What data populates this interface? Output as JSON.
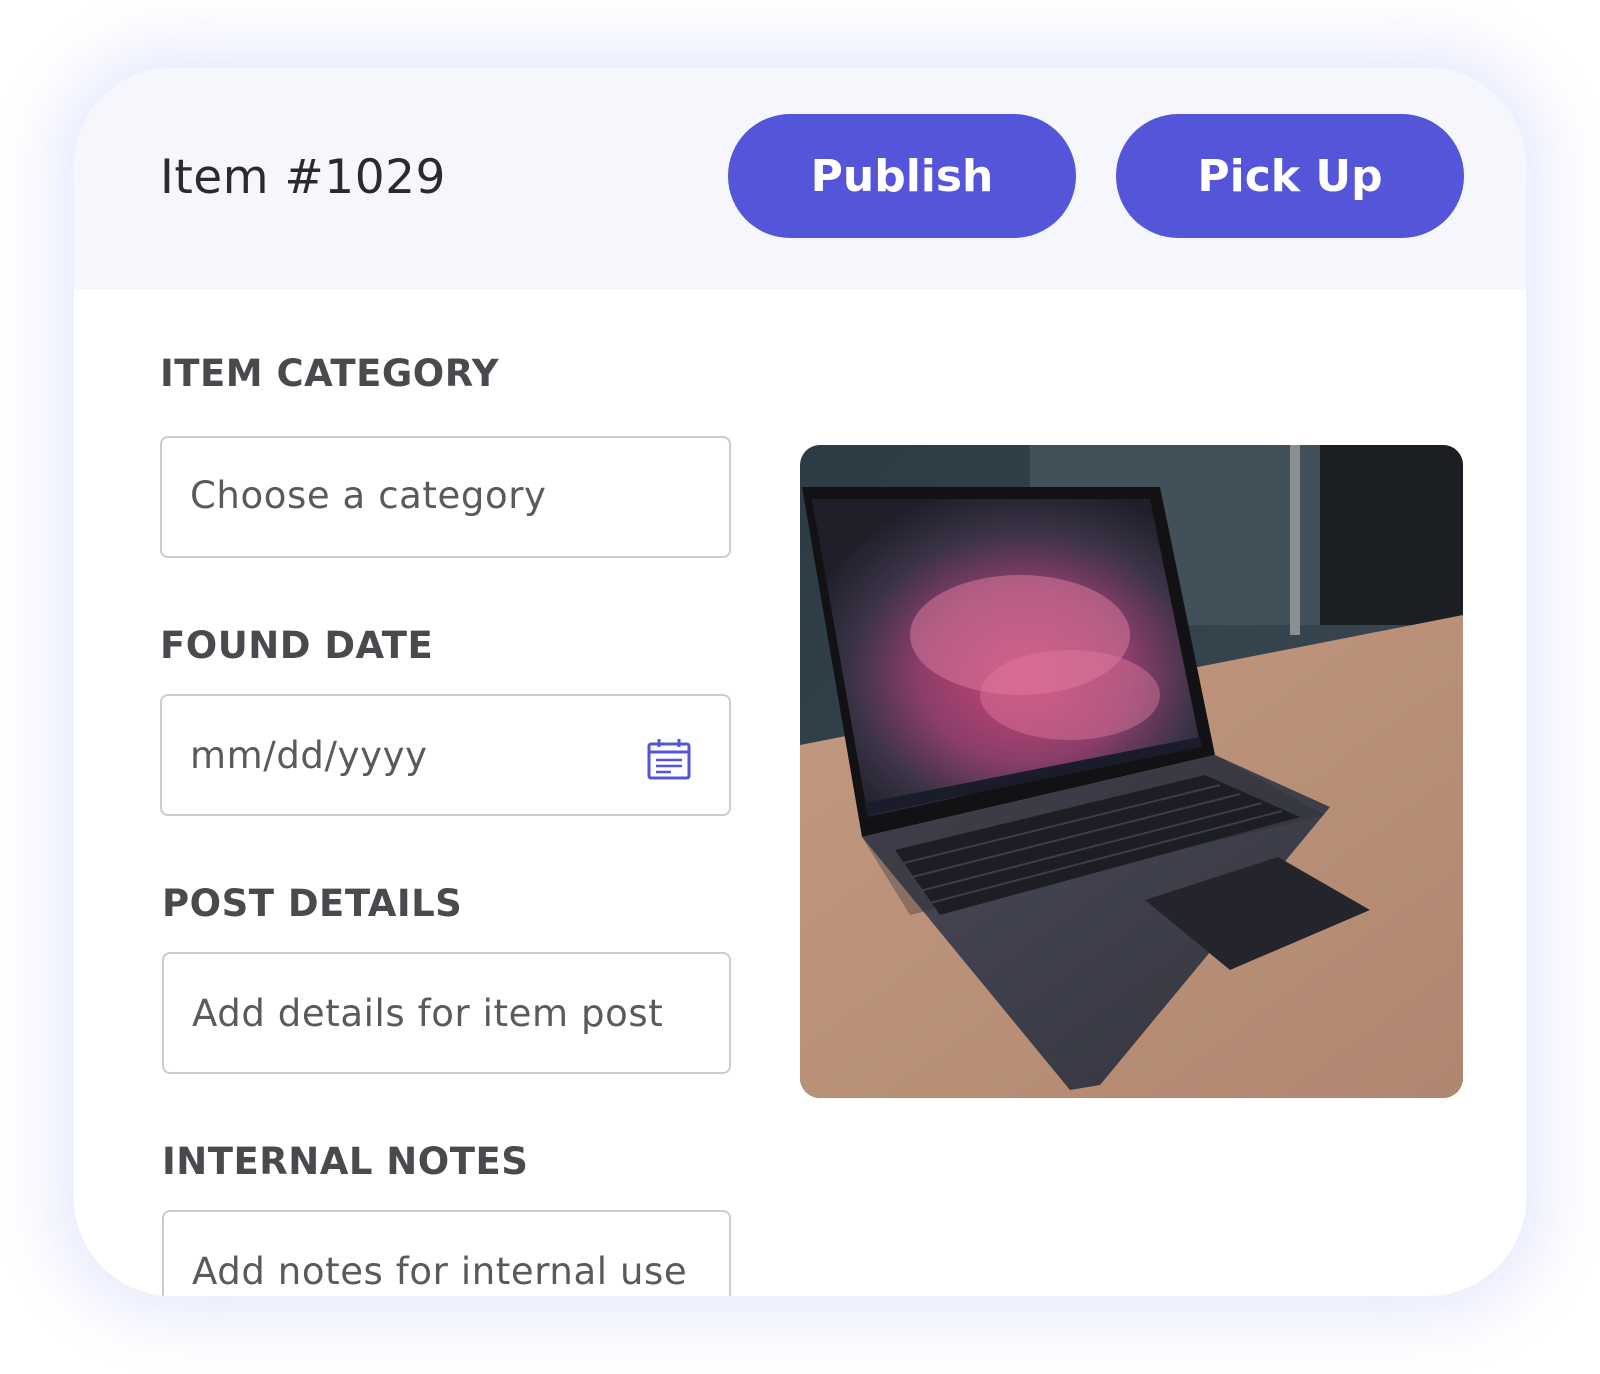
{
  "header": {
    "title": "Item #1029",
    "publish_label": "Publish",
    "pickup_label": "Pick Up"
  },
  "form": {
    "category": {
      "label": "ITEM CATEGORY",
      "placeholder": "Choose a category"
    },
    "found_date": {
      "label": "FOUND DATE",
      "placeholder": "mm/dd/yyyy",
      "icon": "calendar-icon"
    },
    "post_details": {
      "label": "POST DETAILS",
      "placeholder": "Add details for item post"
    },
    "internal_notes": {
      "label": "INTERNAL NOTES",
      "placeholder": "Add notes for internal use"
    }
  },
  "photo": {
    "subject": "laptop on a desk"
  },
  "colors": {
    "accent": "#5455d9",
    "header_bg": "#f6f7fd",
    "field_border": "#c8cdd2",
    "text_dark": "#2b2b2e",
    "label_text": "#4a4a4e"
  }
}
